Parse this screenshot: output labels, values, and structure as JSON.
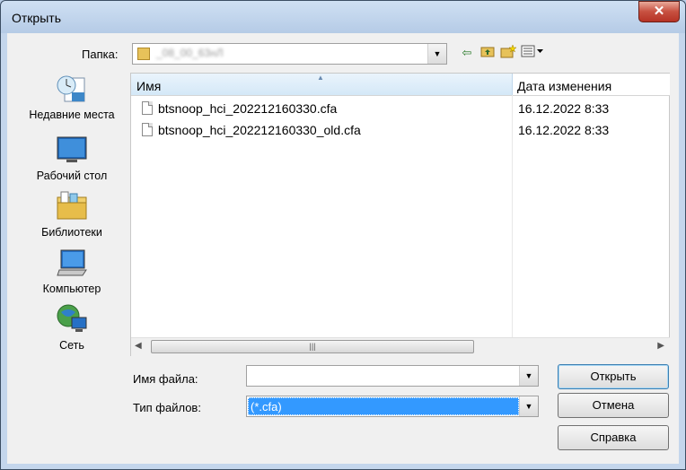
{
  "window": {
    "title": "Открыть",
    "close_label": "✕"
  },
  "toolbar": {
    "folder_label": "Папка:",
    "folder_value": "_08_00_63нЛ",
    "back_icon": "back-arrow-icon",
    "up_icon": "folder-up-icon",
    "new_folder_icon": "new-folder-icon",
    "view_menu_icon": "view-menu-icon"
  },
  "places": [
    {
      "label": "Недавние места",
      "icon": "recent-places-icon"
    },
    {
      "label": "Рабочий стол",
      "icon": "desktop-icon"
    },
    {
      "label": "Библиотеки",
      "icon": "libraries-icon"
    },
    {
      "label": "Компьютер",
      "icon": "computer-icon"
    },
    {
      "label": "Сеть",
      "icon": "network-icon"
    }
  ],
  "file_list": {
    "columns": [
      "Имя",
      "Дата изменения"
    ],
    "rows": [
      {
        "name": "btsnoop_hci_202212160330.cfa",
        "date": "16.12.2022 8:33"
      },
      {
        "name": "btsnoop_hci_202212160330_old.cfa",
        "date": "16.12.2022 8:33"
      }
    ]
  },
  "form": {
    "filename_label": "Имя файла:",
    "filename_value": "",
    "filetype_label": "Тип файлов:",
    "filetype_value": "(*.cfa)"
  },
  "buttons": {
    "open": "Открыть",
    "cancel": "Отмена",
    "help": "Справка"
  },
  "colors": {
    "selection": "#3399ff",
    "header_accent": "#d4e8f7"
  }
}
